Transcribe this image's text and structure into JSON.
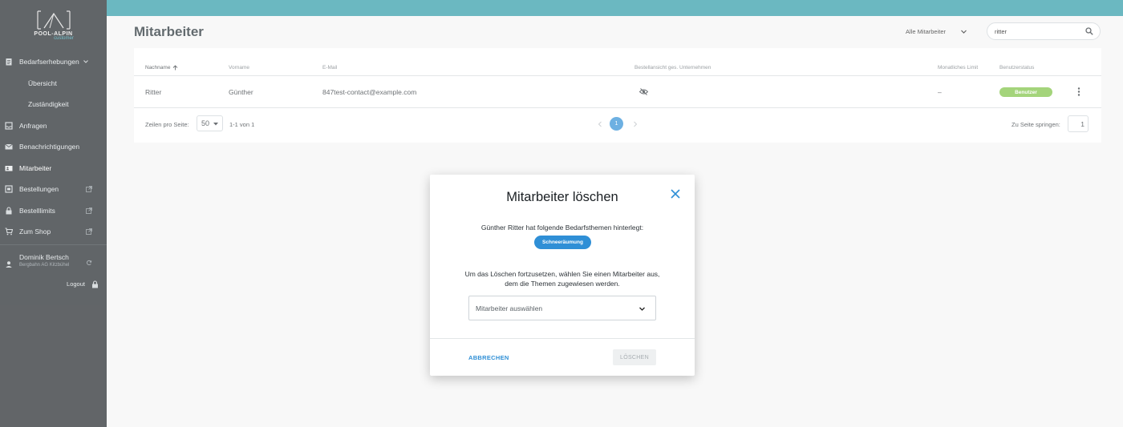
{
  "app": {
    "brand": "POOL-ALPIN",
    "brand_sub": "customer"
  },
  "sidebar": {
    "items": [
      {
        "label": "Bedarfserhebungen",
        "icon": "clipboard-icon"
      },
      {
        "label": "Übersicht"
      },
      {
        "label": "Zuständigkeit"
      },
      {
        "label": "Anfragen",
        "icon": "inbox-icon"
      },
      {
        "label": "Benachrichtigungen",
        "icon": "mail-icon"
      },
      {
        "label": "Mitarbeiter",
        "icon": "contacts-icon"
      },
      {
        "label": "Bestellungen",
        "icon": "receipt-icon"
      },
      {
        "label": "Bestelllimits",
        "icon": "lock-icon"
      },
      {
        "label": "Zum Shop",
        "icon": "cart-icon"
      }
    ],
    "user": {
      "name": "Dominik Bertsch",
      "company": "Bergbahn AG Kitzbühel"
    },
    "logout_label": "Logout"
  },
  "header": {
    "title": "Mitarbeiter",
    "filter_value": "Alle Mitarbeiter",
    "search_value": "ritter"
  },
  "table": {
    "columns": {
      "nachname": "Nachname",
      "vorname": "Vorname",
      "email": "E-Mail",
      "bestellansicht": "Bestellansicht ges. Unternehmen",
      "limit": "Monatliches Limit",
      "status": "Benutzerstatus"
    },
    "rows": [
      {
        "nachname": "Ritter",
        "vorname": "Günther",
        "email": "847test-contact@example.com",
        "limit": "–",
        "status": "Benutzer"
      }
    ],
    "pagination": {
      "rows_per_page_label": "Zeilen pro Seite:",
      "rows_per_page": "50",
      "range": "1-1 von 1",
      "current_page": "1",
      "jump_label": "Zu Seite springen:",
      "jump_value": "1"
    }
  },
  "modal": {
    "title": "Mitarbeiter löschen",
    "text1": "Günther Ritter hat folgende Bedarfsthemen hinterlegt:",
    "chip": "Schneeräumung",
    "text2": "Um das Löschen fortzusetzen, wählen Sie einen Mitarbeiter aus, dem die Themen zugewiesen werden.",
    "select_placeholder": "Mitarbeiter auswählen",
    "cancel_label": "ABBRECHEN",
    "delete_label": "LÖSCHEN"
  },
  "colors": {
    "sidebar_bg": "#1e2327",
    "topbar": "#2c9aa6",
    "accent": "#2f8fd6",
    "status_green": "#7dc242"
  }
}
